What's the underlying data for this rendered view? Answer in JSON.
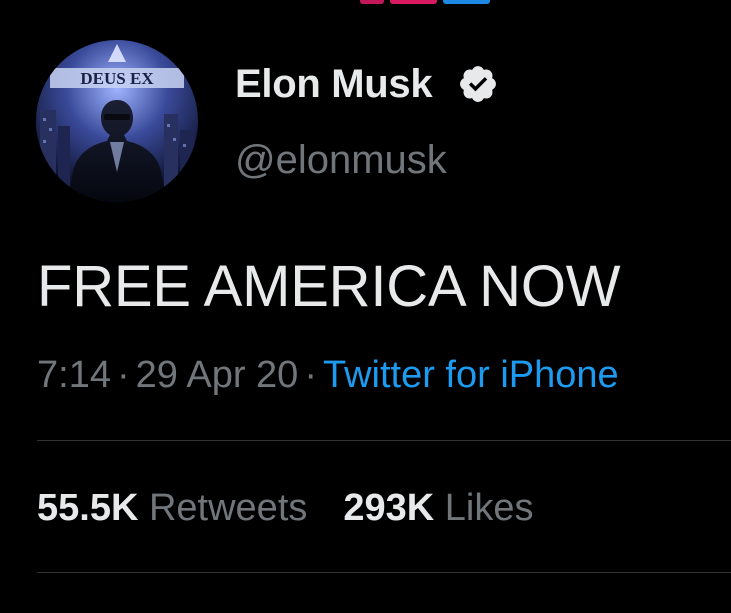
{
  "colors": {
    "background": "#000000",
    "primary_text": "#e7e9ea",
    "secondary_text": "#71767b",
    "link": "#1d9bf0",
    "divider": "#2f3336"
  },
  "author": {
    "avatar_text": "DEUS EX",
    "display_name": "Elon Musk",
    "verified_icon": "verified-badge-icon",
    "handle": "@elonmusk"
  },
  "tweet": {
    "text": "FREE AMERICA NOW",
    "time": "7:14",
    "date": "29 Apr 20",
    "source": "Twitter for iPhone",
    "separator": "·"
  },
  "stats": {
    "retweets_count": "55.5K",
    "retweets_label": "Retweets",
    "likes_count": "293K",
    "likes_label": "Likes"
  }
}
